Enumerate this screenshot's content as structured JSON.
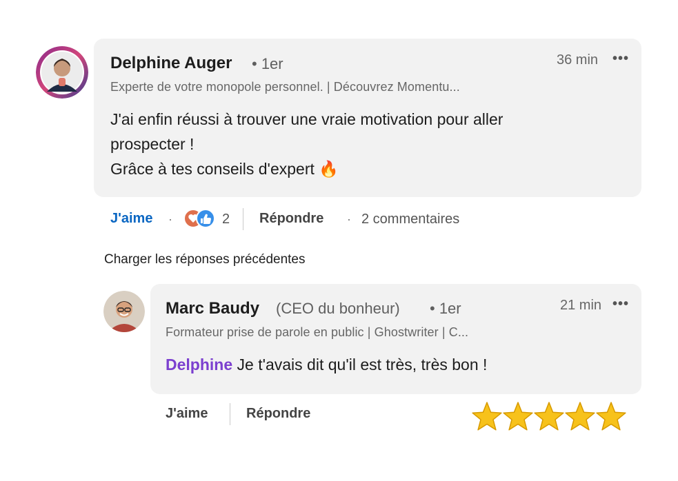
{
  "comment": {
    "author": "Delphine Auger",
    "degree": "• 1er",
    "headline": "Experte de votre monopole personnel. | Découvrez Momentu...",
    "time": "36 min",
    "more": "•••",
    "lines": [
      "J'ai enfin réussi à trouver une vraie motivation pour aller",
      "prospecter !",
      "Grâce à tes conseils d'expert 🔥"
    ],
    "actions": {
      "like": "J'aime",
      "sep": "·",
      "reactions_count": "2",
      "reply": "Répondre",
      "replies_count": "2 commentaires"
    }
  },
  "load_previous": "Charger les réponses précédentes",
  "reply": {
    "author": "Marc Baudy",
    "title": "(CEO du bonheur)",
    "degree": "• 1er",
    "headline": "Formateur prise de parole en public | Ghostwriter | C...",
    "time": "21 min",
    "more": "•••",
    "mention": "Delphine",
    "text": " Je t'avais dit qu'il est très, très bon !",
    "actions": {
      "like": "J'aime",
      "reply": "Répondre"
    }
  },
  "rating": {
    "stars": 5,
    "max": 5,
    "color": "#f7c21b"
  },
  "colors": {
    "accent": "#0a66c2",
    "mention": "#7b3fcf",
    "bubble": "#f2f2f2"
  },
  "icons": [
    "heart-reaction-icon",
    "like-reaction-icon",
    "star-icon"
  ]
}
